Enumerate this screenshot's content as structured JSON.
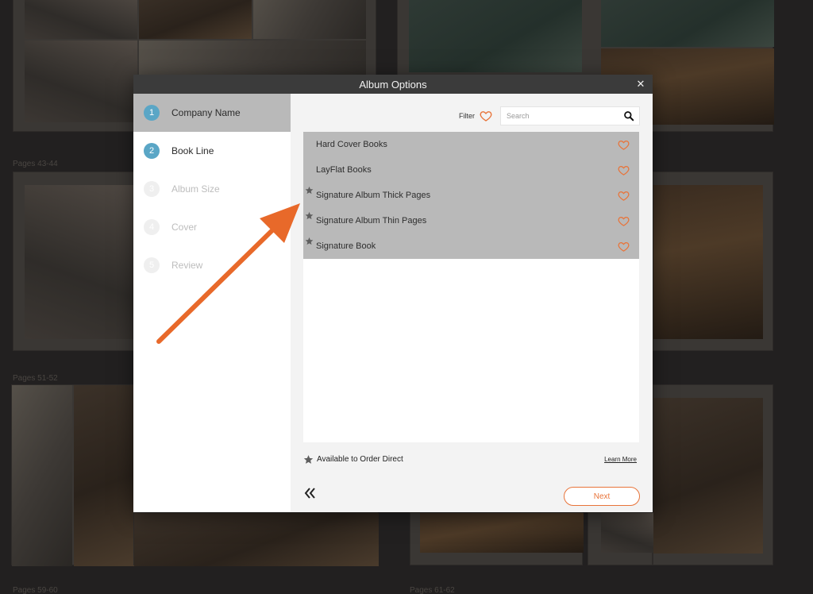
{
  "dialog": {
    "title": "Album Options"
  },
  "steps": [
    {
      "number": "1",
      "label": "Company Name",
      "state": "completed"
    },
    {
      "number": "2",
      "label": "Book Line",
      "state": "current"
    },
    {
      "number": "3",
      "label": "Album Size",
      "state": "disabled"
    },
    {
      "number": "4",
      "label": "Cover",
      "state": "disabled"
    },
    {
      "number": "5",
      "label": "Review",
      "state": "disabled"
    }
  ],
  "filter": {
    "label": "Filter",
    "search_placeholder": "Search"
  },
  "book_lines": [
    {
      "label": "Hard Cover Books",
      "direct_order": false
    },
    {
      "label": "LayFlat Books",
      "direct_order": false
    },
    {
      "label": "Signature Album Thick Pages",
      "direct_order": true
    },
    {
      "label": "Signature Album Thin Pages",
      "direct_order": true
    },
    {
      "label": "Signature Book",
      "direct_order": true
    }
  ],
  "legend": {
    "text": "Available to Order Direct",
    "learn_more": "Learn More"
  },
  "footer": {
    "next_label": "Next"
  },
  "background": {
    "page_labels": [
      "Pages 43-44",
      "Pages 51-52",
      "Pages 59-60",
      "Pages 61-62"
    ]
  },
  "colors": {
    "accent_orange": "#e8743a",
    "step_blue": "#5aa6c6",
    "titlebar": "#3b3b3b",
    "selected_row": "#b9b9b9"
  },
  "icons": {
    "close": "close-icon",
    "filter": "heart-outline-icon",
    "search": "search-icon",
    "favorite": "heart-outline-icon",
    "direct": "star-icon",
    "back": "double-chevron-left-icon"
  }
}
